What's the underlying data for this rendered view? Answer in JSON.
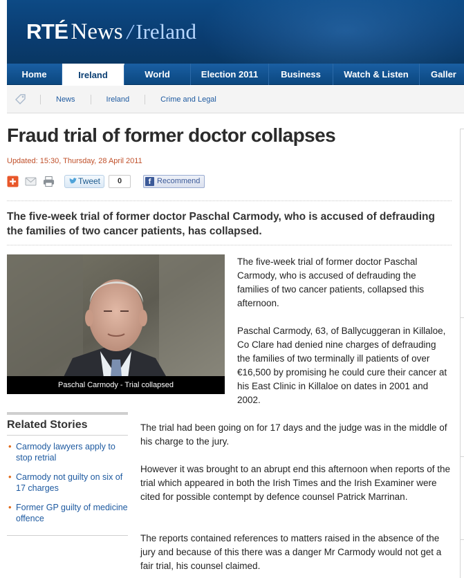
{
  "site": {
    "logo_brand": "RTÉ",
    "logo_product": "News",
    "logo_separator": "/",
    "logo_section": "Ireland",
    "colors": {
      "header_blue": "#0a3d6e",
      "link_blue": "#1e5aa0",
      "accent_orange": "#c0502a"
    }
  },
  "nav": {
    "items": [
      {
        "label": "Home",
        "active": false
      },
      {
        "label": "Ireland",
        "active": true
      },
      {
        "label": "World",
        "active": false
      },
      {
        "label": "Election 2011",
        "active": false
      },
      {
        "label": "Business",
        "active": false
      },
      {
        "label": "Watch & Listen",
        "active": false
      },
      {
        "label": "Galler",
        "active": false
      }
    ]
  },
  "breadcrumb": {
    "icon": "tag-icon",
    "items": [
      "News",
      "Ireland",
      "Crime and Legal"
    ]
  },
  "article": {
    "headline": "Fraud trial of former doctor collapses",
    "updated": "Updated: 15:30, Thursday, 28 April 2011",
    "standfirst": "The five-week trial of former doctor Paschal Carmody, who is accused of defrauding the families of two cancer patients, has collapsed.",
    "photo_caption": "Paschal Carmody - Trial collapsed",
    "paragraphs": [
      "The five-week trial of former doctor Paschal Carmody, who is accused of defrauding the families of two cancer patients, collapsed this afternoon.",
      "Paschal Carmody, 63, of Ballycuggeran in Killaloe, Co Clare had denied nine charges of defrauding the families of two terminally ill patients of over €16,500 by promising he could cure their cancer at his East Clinic in Killaloe on dates in 2001 and 2002.",
      "The trial had been going on for 17 days and the judge was in the middle of his charge to the jury.",
      "However it was brought to an abrupt end this afternoon when reports of the trial which appeared in both the Irish Times and the Irish Examiner were cited for possible contempt by defence counsel Patrick Marrinan.",
      "The reports contained references to matters raised in the absence of the jury and because of this there was a danger Mr Carmody would not get a fair trial, his counsel claimed."
    ]
  },
  "share": {
    "icons": [
      "add-icon",
      "email-icon",
      "print-icon"
    ],
    "tweet_label": "Tweet",
    "tweet_count": "0",
    "facebook_label": "Recommend"
  },
  "related": {
    "title": "Related Stories",
    "items": [
      "Carmody lawyers apply to stop retrial",
      "Carmody not guilty on six of 17 charges",
      "Former GP guilty of medicine offence"
    ]
  }
}
